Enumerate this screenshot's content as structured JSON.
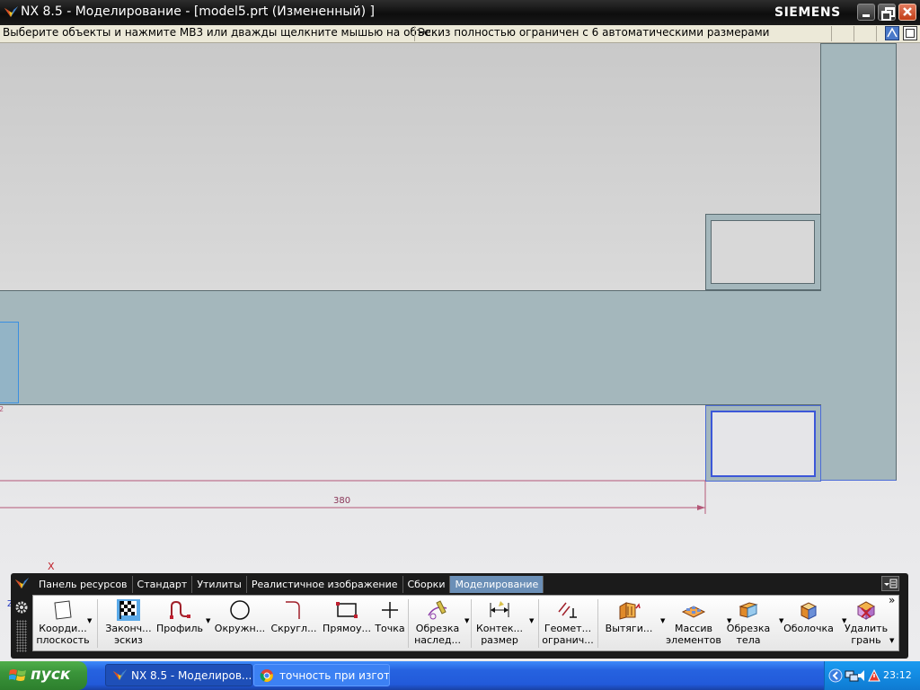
{
  "window": {
    "title": "NX 8.5 - Моделирование - [model5.prt (Измененный) ]",
    "brand": "SIEMENS"
  },
  "status": {
    "left": "Выберите объекты и нажмите MB3 или дважды щелкните мышью на объе...",
    "right": "Эскиз полностью ограничен с 6 автоматическими размерами"
  },
  "canvas": {
    "dimension_value": "380",
    "axis_label": "X",
    "z_label": "Z"
  },
  "toolbar": {
    "tabs": [
      {
        "label": "Панель ресурсов",
        "active": false
      },
      {
        "label": "Стандарт",
        "active": false
      },
      {
        "label": "Утилиты",
        "active": false
      },
      {
        "label": "Реалистичное изображение",
        "active": false
      },
      {
        "label": "Сборки",
        "active": false
      },
      {
        "label": "Моделирование",
        "active": true
      }
    ],
    "items": [
      {
        "label1": "Коорди...",
        "label2": "плоскость",
        "icon": "datum-plane-icon"
      },
      {
        "label1": "Законч...",
        "label2": "эскиз",
        "icon": "finish-sketch-icon"
      },
      {
        "label1": "Профиль",
        "label2": "",
        "icon": "profile-icon"
      },
      {
        "label1": "Окружн...",
        "label2": "",
        "icon": "circle-icon"
      },
      {
        "label1": "Скругл...",
        "label2": "",
        "icon": "fillet-icon"
      },
      {
        "label1": "Прямоу...",
        "label2": "",
        "icon": "rectangle-icon"
      },
      {
        "label1": "Точка",
        "label2": "",
        "icon": "point-icon"
      },
      {
        "label1": "Обрезка",
        "label2": "наслед...",
        "icon": "trim-recipe-icon"
      },
      {
        "label1": "Контек...",
        "label2": "размер",
        "icon": "dimension-icon"
      },
      {
        "label1": "Геомет...",
        "label2": "огранич...",
        "icon": "geometric-constraint-icon"
      },
      {
        "label1": "Вытяги...",
        "label2": "",
        "icon": "extrude-icon"
      },
      {
        "label1": "Массив",
        "label2": "элементов",
        "icon": "pattern-feature-icon"
      },
      {
        "label1": "Обрезка",
        "label2": "тела",
        "icon": "trim-body-icon"
      },
      {
        "label1": "Оболочка",
        "label2": "",
        "icon": "shell-icon"
      },
      {
        "label1": "Удалить",
        "label2": "грань",
        "icon": "delete-face-icon"
      }
    ],
    "overflow": "»"
  },
  "taskbar": {
    "start": "пуск",
    "tasks": [
      {
        "label": "NX 8.5 - Моделиров...",
        "active": true
      },
      {
        "label": "точность при изгот...",
        "active": false
      }
    ],
    "clock": "23:12"
  }
}
